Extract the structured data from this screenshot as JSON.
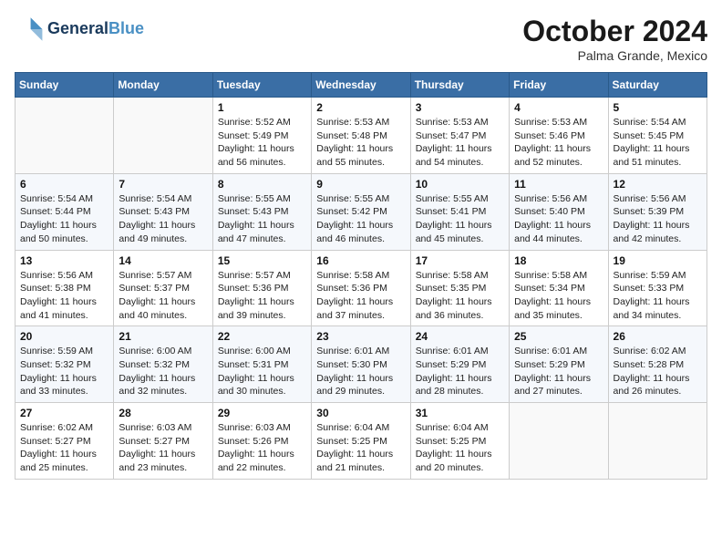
{
  "header": {
    "logo_line1": "General",
    "logo_line2": "Blue",
    "month": "October 2024",
    "location": "Palma Grande, Mexico"
  },
  "days_of_week": [
    "Sunday",
    "Monday",
    "Tuesday",
    "Wednesday",
    "Thursday",
    "Friday",
    "Saturday"
  ],
  "weeks": [
    [
      {
        "day": "",
        "info": ""
      },
      {
        "day": "",
        "info": ""
      },
      {
        "day": "1",
        "info": "Sunrise: 5:52 AM\nSunset: 5:49 PM\nDaylight: 11 hours and 56 minutes."
      },
      {
        "day": "2",
        "info": "Sunrise: 5:53 AM\nSunset: 5:48 PM\nDaylight: 11 hours and 55 minutes."
      },
      {
        "day": "3",
        "info": "Sunrise: 5:53 AM\nSunset: 5:47 PM\nDaylight: 11 hours and 54 minutes."
      },
      {
        "day": "4",
        "info": "Sunrise: 5:53 AM\nSunset: 5:46 PM\nDaylight: 11 hours and 52 minutes."
      },
      {
        "day": "5",
        "info": "Sunrise: 5:54 AM\nSunset: 5:45 PM\nDaylight: 11 hours and 51 minutes."
      }
    ],
    [
      {
        "day": "6",
        "info": "Sunrise: 5:54 AM\nSunset: 5:44 PM\nDaylight: 11 hours and 50 minutes."
      },
      {
        "day": "7",
        "info": "Sunrise: 5:54 AM\nSunset: 5:43 PM\nDaylight: 11 hours and 49 minutes."
      },
      {
        "day": "8",
        "info": "Sunrise: 5:55 AM\nSunset: 5:43 PM\nDaylight: 11 hours and 47 minutes."
      },
      {
        "day": "9",
        "info": "Sunrise: 5:55 AM\nSunset: 5:42 PM\nDaylight: 11 hours and 46 minutes."
      },
      {
        "day": "10",
        "info": "Sunrise: 5:55 AM\nSunset: 5:41 PM\nDaylight: 11 hours and 45 minutes."
      },
      {
        "day": "11",
        "info": "Sunrise: 5:56 AM\nSunset: 5:40 PM\nDaylight: 11 hours and 44 minutes."
      },
      {
        "day": "12",
        "info": "Sunrise: 5:56 AM\nSunset: 5:39 PM\nDaylight: 11 hours and 42 minutes."
      }
    ],
    [
      {
        "day": "13",
        "info": "Sunrise: 5:56 AM\nSunset: 5:38 PM\nDaylight: 11 hours and 41 minutes."
      },
      {
        "day": "14",
        "info": "Sunrise: 5:57 AM\nSunset: 5:37 PM\nDaylight: 11 hours and 40 minutes."
      },
      {
        "day": "15",
        "info": "Sunrise: 5:57 AM\nSunset: 5:36 PM\nDaylight: 11 hours and 39 minutes."
      },
      {
        "day": "16",
        "info": "Sunrise: 5:58 AM\nSunset: 5:36 PM\nDaylight: 11 hours and 37 minutes."
      },
      {
        "day": "17",
        "info": "Sunrise: 5:58 AM\nSunset: 5:35 PM\nDaylight: 11 hours and 36 minutes."
      },
      {
        "day": "18",
        "info": "Sunrise: 5:58 AM\nSunset: 5:34 PM\nDaylight: 11 hours and 35 minutes."
      },
      {
        "day": "19",
        "info": "Sunrise: 5:59 AM\nSunset: 5:33 PM\nDaylight: 11 hours and 34 minutes."
      }
    ],
    [
      {
        "day": "20",
        "info": "Sunrise: 5:59 AM\nSunset: 5:32 PM\nDaylight: 11 hours and 33 minutes."
      },
      {
        "day": "21",
        "info": "Sunrise: 6:00 AM\nSunset: 5:32 PM\nDaylight: 11 hours and 32 minutes."
      },
      {
        "day": "22",
        "info": "Sunrise: 6:00 AM\nSunset: 5:31 PM\nDaylight: 11 hours and 30 minutes."
      },
      {
        "day": "23",
        "info": "Sunrise: 6:01 AM\nSunset: 5:30 PM\nDaylight: 11 hours and 29 minutes."
      },
      {
        "day": "24",
        "info": "Sunrise: 6:01 AM\nSunset: 5:29 PM\nDaylight: 11 hours and 28 minutes."
      },
      {
        "day": "25",
        "info": "Sunrise: 6:01 AM\nSunset: 5:29 PM\nDaylight: 11 hours and 27 minutes."
      },
      {
        "day": "26",
        "info": "Sunrise: 6:02 AM\nSunset: 5:28 PM\nDaylight: 11 hours and 26 minutes."
      }
    ],
    [
      {
        "day": "27",
        "info": "Sunrise: 6:02 AM\nSunset: 5:27 PM\nDaylight: 11 hours and 25 minutes."
      },
      {
        "day": "28",
        "info": "Sunrise: 6:03 AM\nSunset: 5:27 PM\nDaylight: 11 hours and 23 minutes."
      },
      {
        "day": "29",
        "info": "Sunrise: 6:03 AM\nSunset: 5:26 PM\nDaylight: 11 hours and 22 minutes."
      },
      {
        "day": "30",
        "info": "Sunrise: 6:04 AM\nSunset: 5:25 PM\nDaylight: 11 hours and 21 minutes."
      },
      {
        "day": "31",
        "info": "Sunrise: 6:04 AM\nSunset: 5:25 PM\nDaylight: 11 hours and 20 minutes."
      },
      {
        "day": "",
        "info": ""
      },
      {
        "day": "",
        "info": ""
      }
    ]
  ]
}
